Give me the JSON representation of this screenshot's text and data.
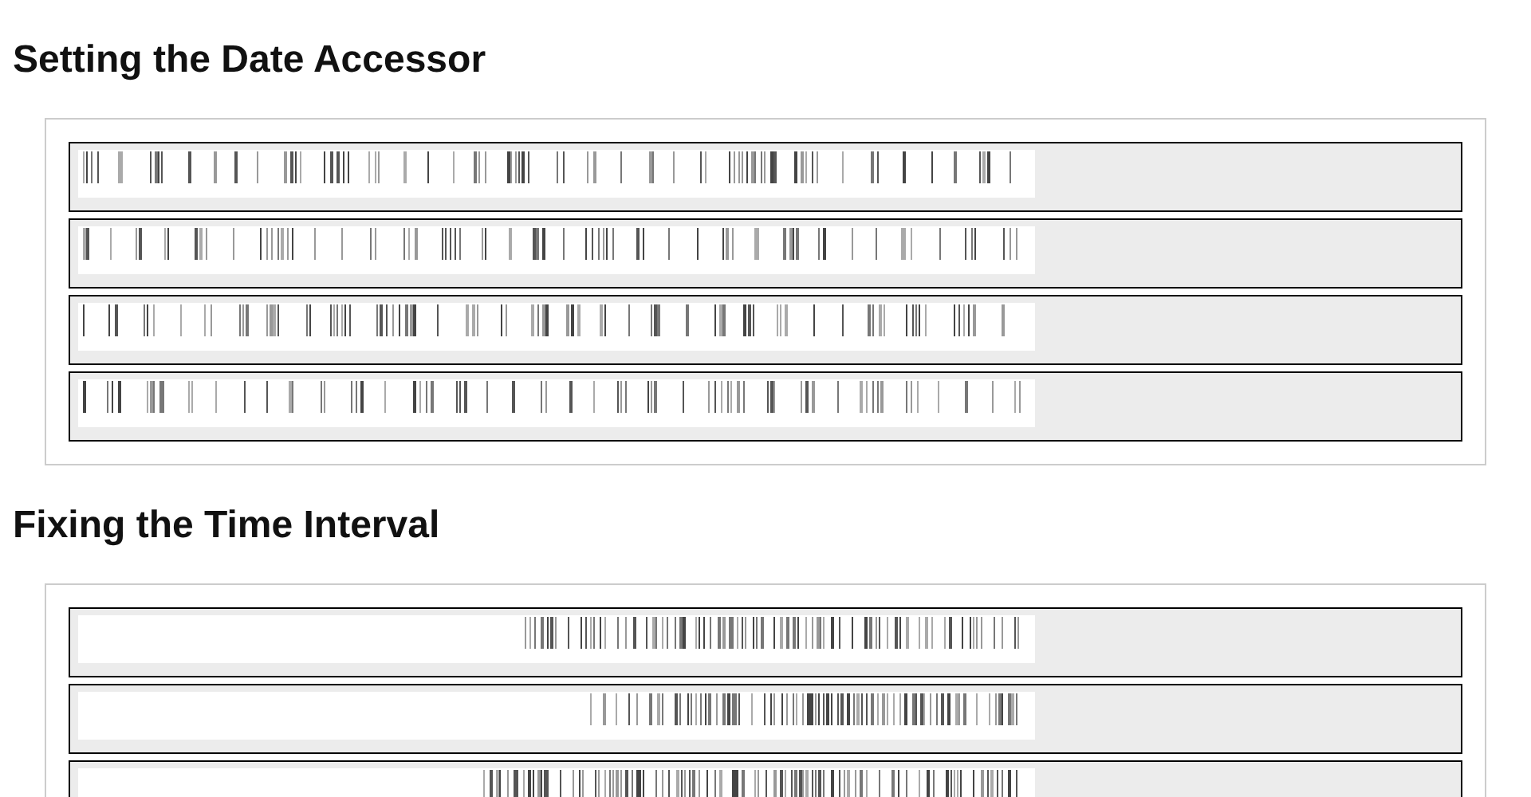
{
  "sections": [
    {
      "title": "Setting the Date Accessor",
      "strips": [
        {
          "kind": "spread"
        },
        {
          "kind": "spread"
        },
        {
          "kind": "spread"
        },
        {
          "kind": "spread"
        }
      ]
    },
    {
      "title": "Fixing the Time Interval",
      "strips": [
        {
          "kind": "recent"
        },
        {
          "kind": "recent"
        },
        {
          "kind": "recent"
        }
      ]
    }
  ]
}
